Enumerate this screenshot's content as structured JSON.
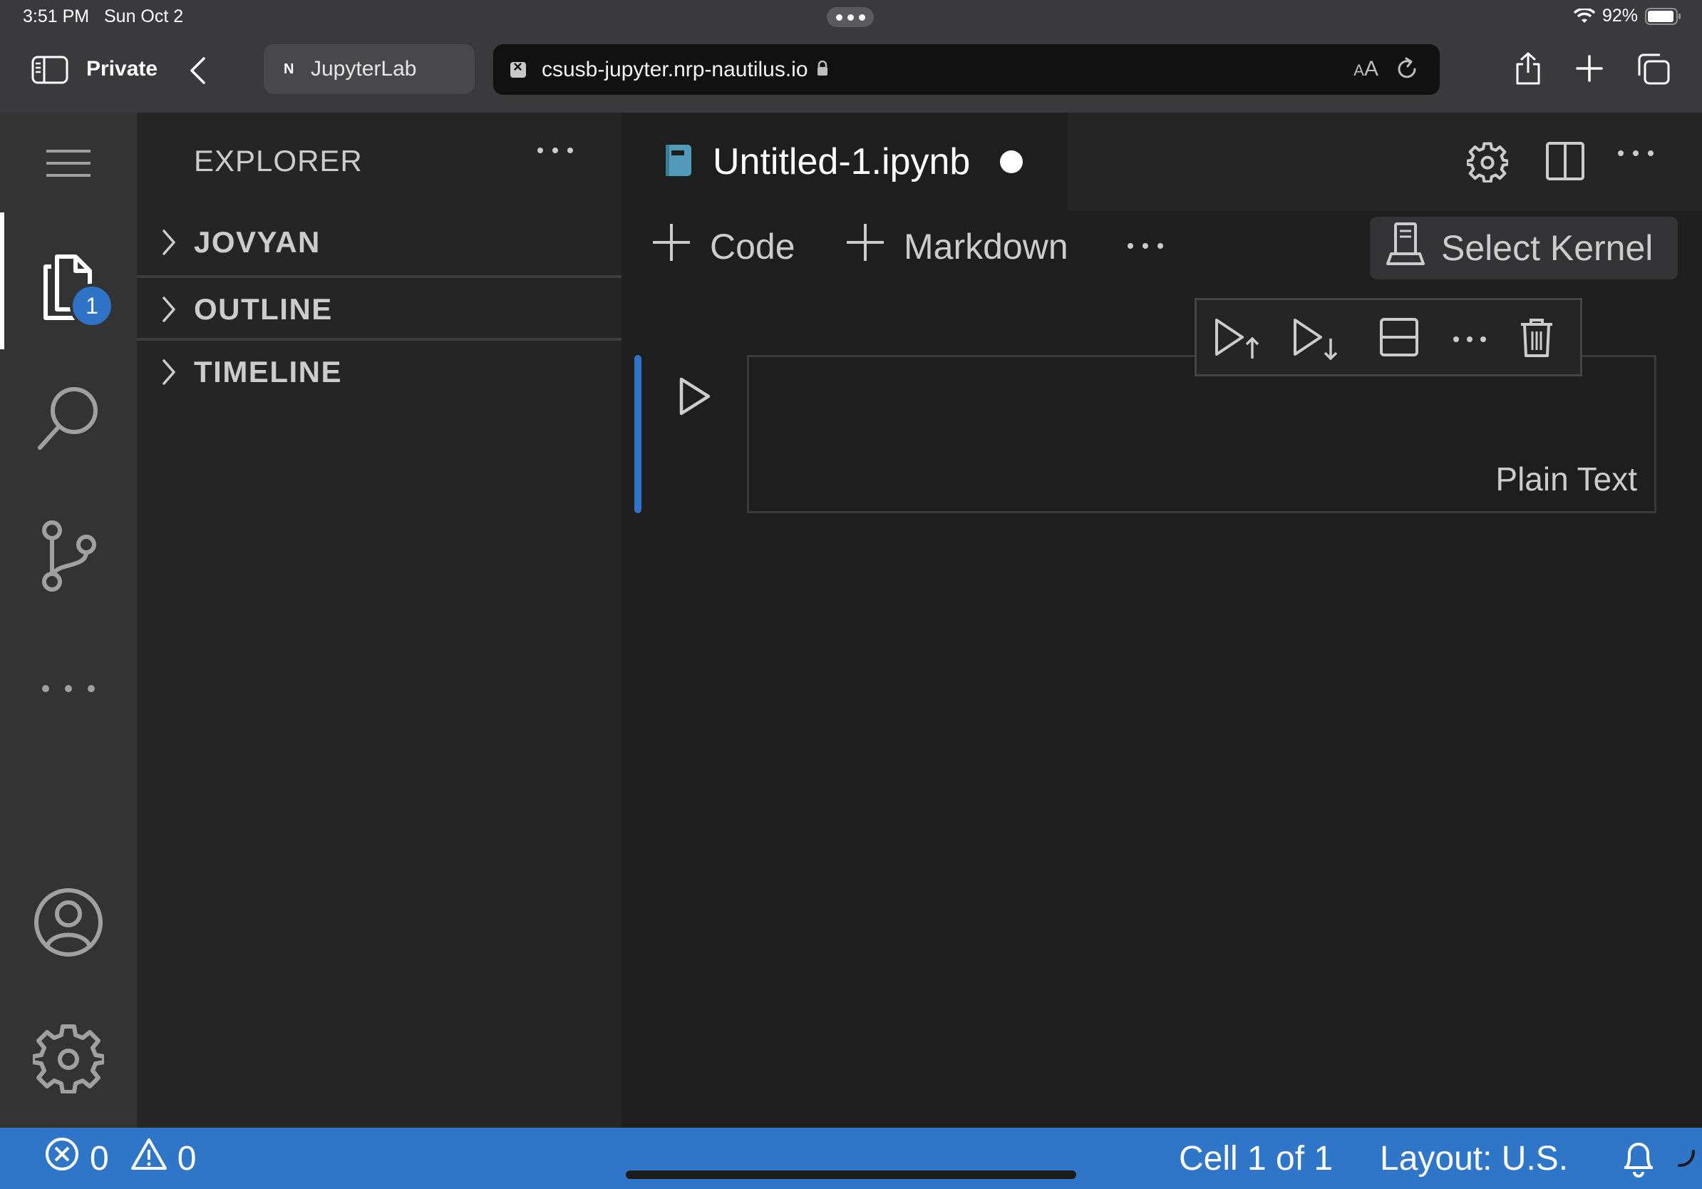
{
  "ios_status": {
    "time": "3:51 PM",
    "date": "Sun Oct 2",
    "battery": "92%"
  },
  "safari": {
    "private_label": "Private",
    "tab_title": "JupyterLab",
    "tab_favicon": "N",
    "url": "csusb-jupyter.nrp-nautilus.io",
    "aa_label_small": "A",
    "aa_label_large": "A"
  },
  "activity_bar": {
    "explorer_badge": "1"
  },
  "side_panel": {
    "title": "EXPLORER",
    "sections": [
      {
        "label": "JOVYAN"
      },
      {
        "label": "OUTLINE"
      },
      {
        "label": "TIMELINE"
      }
    ]
  },
  "editor": {
    "tab_name": "Untitled-1.ipynb",
    "toolbar": {
      "code_label": "Code",
      "markdown_label": "Markdown",
      "kernel_label": "Select Kernel"
    },
    "cell": {
      "language": "Plain Text"
    }
  },
  "status_bar": {
    "errors": "0",
    "warnings": "0",
    "cell_position": "Cell 1 of 1",
    "layout": "Layout: U.S."
  },
  "colors": {
    "accent": "#3076c8",
    "activity_bar": "#333333",
    "side_panel": "#252526",
    "editor_bg": "#1e1e1e"
  }
}
